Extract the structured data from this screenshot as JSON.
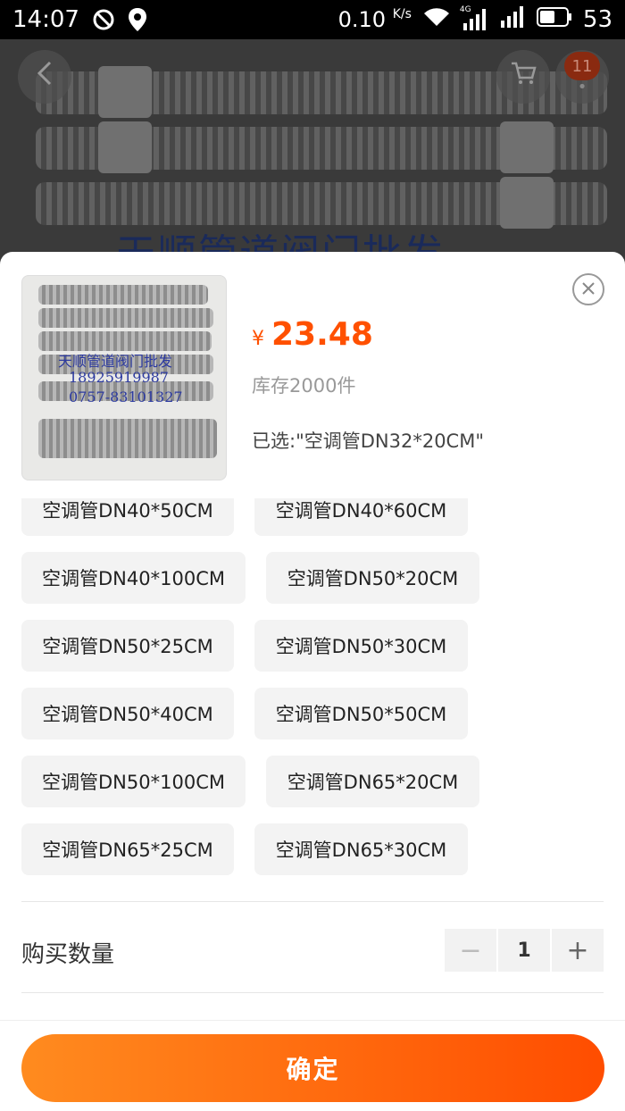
{
  "status_bar": {
    "time": "14:07",
    "speed": "0.10",
    "speed_unit": "K/s",
    "network": "4G",
    "battery": "53"
  },
  "backdrop": {
    "watermark": "天顺管道阀门批发",
    "cart_badge": "11"
  },
  "product": {
    "thumb_watermark_lines": [
      "天顺管道阀门批发",
      "18925919987",
      "0757-83101327"
    ],
    "currency": "¥",
    "price": "23.48",
    "stock": "库存2000件",
    "selected": "已选:\"空调管DN32*20CM\""
  },
  "options": [
    "空调管DN40*50CM",
    "空调管DN40*60CM",
    "空调管DN40*100CM",
    "空调管DN50*20CM",
    "空调管DN50*25CM",
    "空调管DN50*30CM",
    "空调管DN50*40CM",
    "空调管DN50*50CM",
    "空调管DN50*100CM",
    "空调管DN65*20CM",
    "空调管DN65*25CM",
    "空调管DN65*30CM"
  ],
  "quantity": {
    "label": "购买数量",
    "minus": "−",
    "value": "1",
    "plus": "+"
  },
  "confirm_label": "确定",
  "colors": {
    "accent": "#ff5000",
    "button_start": "#ff8b1f",
    "button_end": "#ff4d00"
  }
}
